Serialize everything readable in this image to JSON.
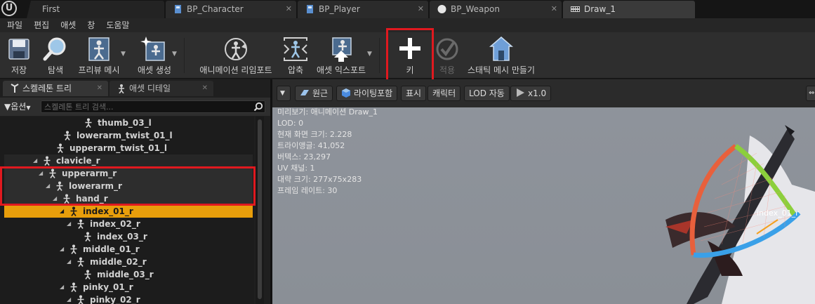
{
  "tabs": [
    {
      "label": "First",
      "icon": "level-icon"
    },
    {
      "label": "BP_Character",
      "icon": "blueprint-icon"
    },
    {
      "label": "BP_Player",
      "icon": "blueprint-icon"
    },
    {
      "label": "BP_Weapon",
      "icon": "sphere-icon"
    },
    {
      "label": "Draw_1",
      "icon": "animation-sequence-icon"
    }
  ],
  "menu": [
    "파일",
    "편집",
    "애셋",
    "창",
    "도움말"
  ],
  "toolbar": {
    "save": "저장",
    "browse": "탐색",
    "preview_mesh": "프리뷰 메시",
    "create_asset": "애셋 생성",
    "retarget": "애니메이션 리임포트",
    "compress": "압축",
    "export_asset": "애셋 익스포트",
    "key": "키",
    "apply": "적용",
    "make_static_mesh": "스태틱 메시 만들기"
  },
  "panel_tabs": {
    "skeleton_tree": "스켈레톤 트리",
    "asset_details": "애셋 디테일"
  },
  "filter": {
    "options": "옵션",
    "search_placeholder": "스켈레톤 트리 검색..."
  },
  "bones": [
    {
      "name": "thumb_03_l",
      "expander": false
    },
    {
      "name": "lowerarm_twist_01_l",
      "expander": false
    },
    {
      "name": "upperarm_twist_01_l",
      "expander": false
    },
    {
      "name": "clavicle_r",
      "expander": true
    },
    {
      "name": "upperarm_r",
      "expander": true
    },
    {
      "name": "lowerarm_r",
      "expander": true
    },
    {
      "name": "hand_r",
      "expander": true
    },
    {
      "name": "index_01_r",
      "expander": true,
      "selected": true
    },
    {
      "name": "index_02_r",
      "expander": true
    },
    {
      "name": "index_03_r",
      "expander": false
    },
    {
      "name": "middle_01_r",
      "expander": true
    },
    {
      "name": "middle_02_r",
      "expander": true
    },
    {
      "name": "middle_03_r",
      "expander": false
    },
    {
      "name": "pinky_01_r",
      "expander": true
    },
    {
      "name": "pinky_02_r",
      "expander": true
    }
  ],
  "viewport": {
    "perspective": "원근",
    "lighting": "라이팅포함",
    "show": "표시",
    "character": "캐릭터",
    "lod": "LOD 자동",
    "speed": "x1.0",
    "info": [
      "미리보기: 애니메이션 Draw_1",
      "LOD: 0",
      "현재 화면 크기: 2.228",
      "트라이앵글: 41,052",
      "버텍스: 23,297",
      "UV 채널: 1",
      "대략 크기: 277x75x283",
      "프레임 레이트: 30"
    ],
    "selected_bone_label": "index_01_r"
  },
  "colors": {
    "highlight_red": "#e0191f",
    "selection_orange": "#e89e0b",
    "gizmo_red": "#e8603c",
    "gizmo_green": "#8ccf3c",
    "gizmo_blue": "#3aa0e8"
  }
}
